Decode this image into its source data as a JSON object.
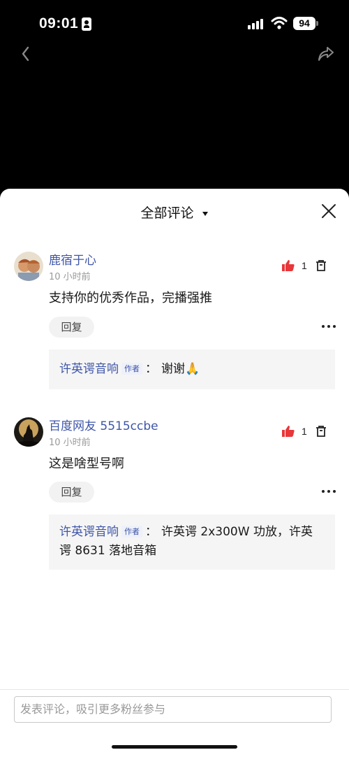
{
  "status_bar": {
    "time": "09:01",
    "battery": "94"
  },
  "icons": {
    "back": "chevron-left-icon",
    "share": "share-arrow-icon",
    "close": "close-icon",
    "like": "thumbs-up-icon",
    "delete": "trash-icon",
    "more": "more-dots-icon",
    "caret": "caret-down-icon"
  },
  "sheet": {
    "title": "全部评论"
  },
  "comments": [
    {
      "username": "鹿宿于心",
      "time": "10 小时前",
      "text": "支持你的优秀作品，完播强推",
      "likes": "1",
      "reply_label": "回复",
      "reply": {
        "author": "许英谔音响",
        "tag": "作者",
        "sep": "：",
        "text": "谢谢🙏"
      }
    },
    {
      "username": "百度网友 5515ccbe",
      "time": "10 小时前",
      "text": "这是啥型号啊",
      "likes": "1",
      "reply_label": "回复",
      "reply": {
        "author": "许英谔音响",
        "tag": "作者",
        "sep": "：",
        "text": "许英谔 2x300W 功放，许英谔 8631 落地音箱"
      }
    }
  ],
  "composer": {
    "placeholder": "发表评论，吸引更多粉丝参与"
  },
  "colors": {
    "link": "#3e55a8",
    "like": "#e8373a"
  }
}
